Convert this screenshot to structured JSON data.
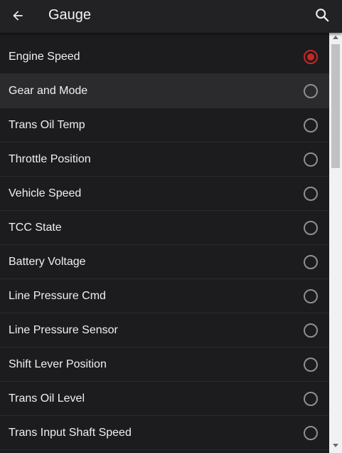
{
  "header": {
    "title": "Gauge",
    "back_icon": "arrow-left-icon",
    "search_icon": "search-icon"
  },
  "list": {
    "items": [
      {
        "label": "Engine Speed",
        "selected": true
      },
      {
        "label": "Gear and Mode",
        "selected": false
      },
      {
        "label": "Trans Oil Temp",
        "selected": false
      },
      {
        "label": "Throttle Position",
        "selected": false
      },
      {
        "label": "Vehicle Speed",
        "selected": false
      },
      {
        "label": "TCC State",
        "selected": false
      },
      {
        "label": "Battery Voltage",
        "selected": false
      },
      {
        "label": "Line Pressure Cmd",
        "selected": false
      },
      {
        "label": "Line Pressure Sensor",
        "selected": false
      },
      {
        "label": "Shift Lever Position",
        "selected": false
      },
      {
        "label": "Trans Oil Level",
        "selected": false
      },
      {
        "label": "Trans Input Shaft Speed",
        "selected": false
      }
    ]
  },
  "colors": {
    "background": "#1c1c1e",
    "header": "#222225",
    "accent": "#c62828",
    "text": "#f0f0f0"
  }
}
